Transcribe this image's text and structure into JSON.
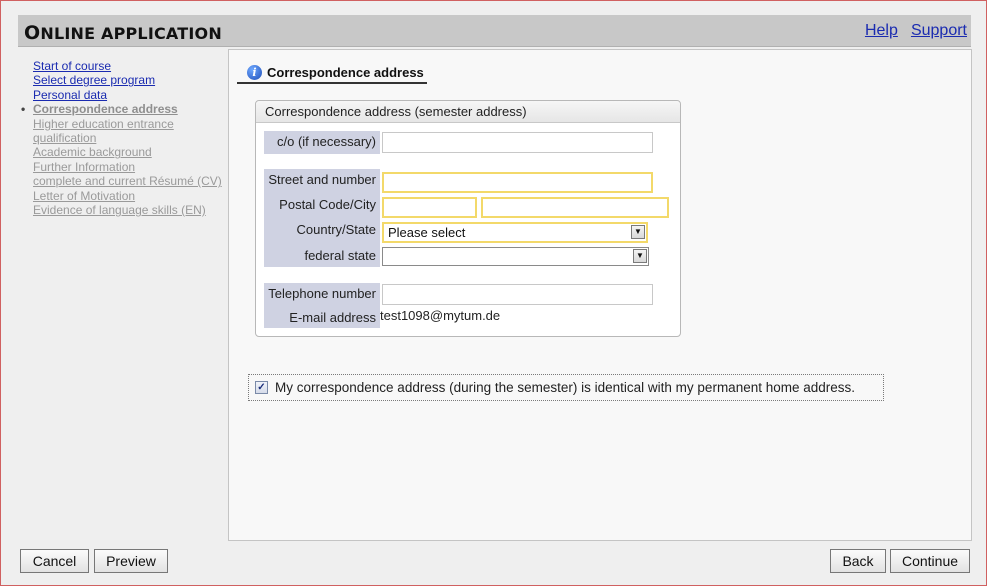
{
  "header": {
    "title_first": "O",
    "title_rest": "NLINE APPLICATION",
    "links": [
      "Help",
      "Support"
    ]
  },
  "nav": {
    "items": [
      {
        "label": "Start of course",
        "state": "done"
      },
      {
        "label": "Select degree program",
        "state": "done"
      },
      {
        "label": "Personal data",
        "state": "done"
      },
      {
        "label": "Correspondence address",
        "state": "current"
      },
      {
        "label": "Higher education entrance",
        "state": "pending"
      },
      {
        "label": "qualification",
        "state": "pending"
      },
      {
        "label": "Academic background",
        "state": "pending"
      },
      {
        "label": "Further Information",
        "state": "pending"
      },
      {
        "label": "complete and current Résumé (CV)",
        "state": "pending"
      },
      {
        "label": "Letter of Motivation",
        "state": "pending"
      },
      {
        "label": "Evidence of language skills (EN)",
        "state": "pending"
      }
    ],
    "bullet": "•"
  },
  "section": {
    "title": "Correspondence address",
    "icon": "info-icon"
  },
  "form": {
    "legend": "Correspondence address (semester address)",
    "co_label": "c/o (if necessary)",
    "co_value": "",
    "street_label": "Street and number",
    "street_value": "",
    "postal_label": "Postal Code/City",
    "postal_value": "",
    "city_value": "",
    "country_label": "Country/State",
    "country_value": "Please select",
    "federal_label": "federal state",
    "federal_value": "",
    "phone_label": "Telephone number",
    "phone_value": "",
    "email_label": "E-mail address",
    "email_value": "test1098@mytum.de"
  },
  "checkbox": {
    "checked": true,
    "label": "My correspondence address (during the semester) is identical with my permanent home address."
  },
  "buttons": {
    "cancel": "Cancel",
    "preview": "Preview",
    "back": "Back",
    "continue": "Continue"
  },
  "colors": {
    "link": "#1a2bb0",
    "required_border": "#f3d96a",
    "label_bg": "#cfd2e2",
    "frame_border": "#d06060"
  }
}
